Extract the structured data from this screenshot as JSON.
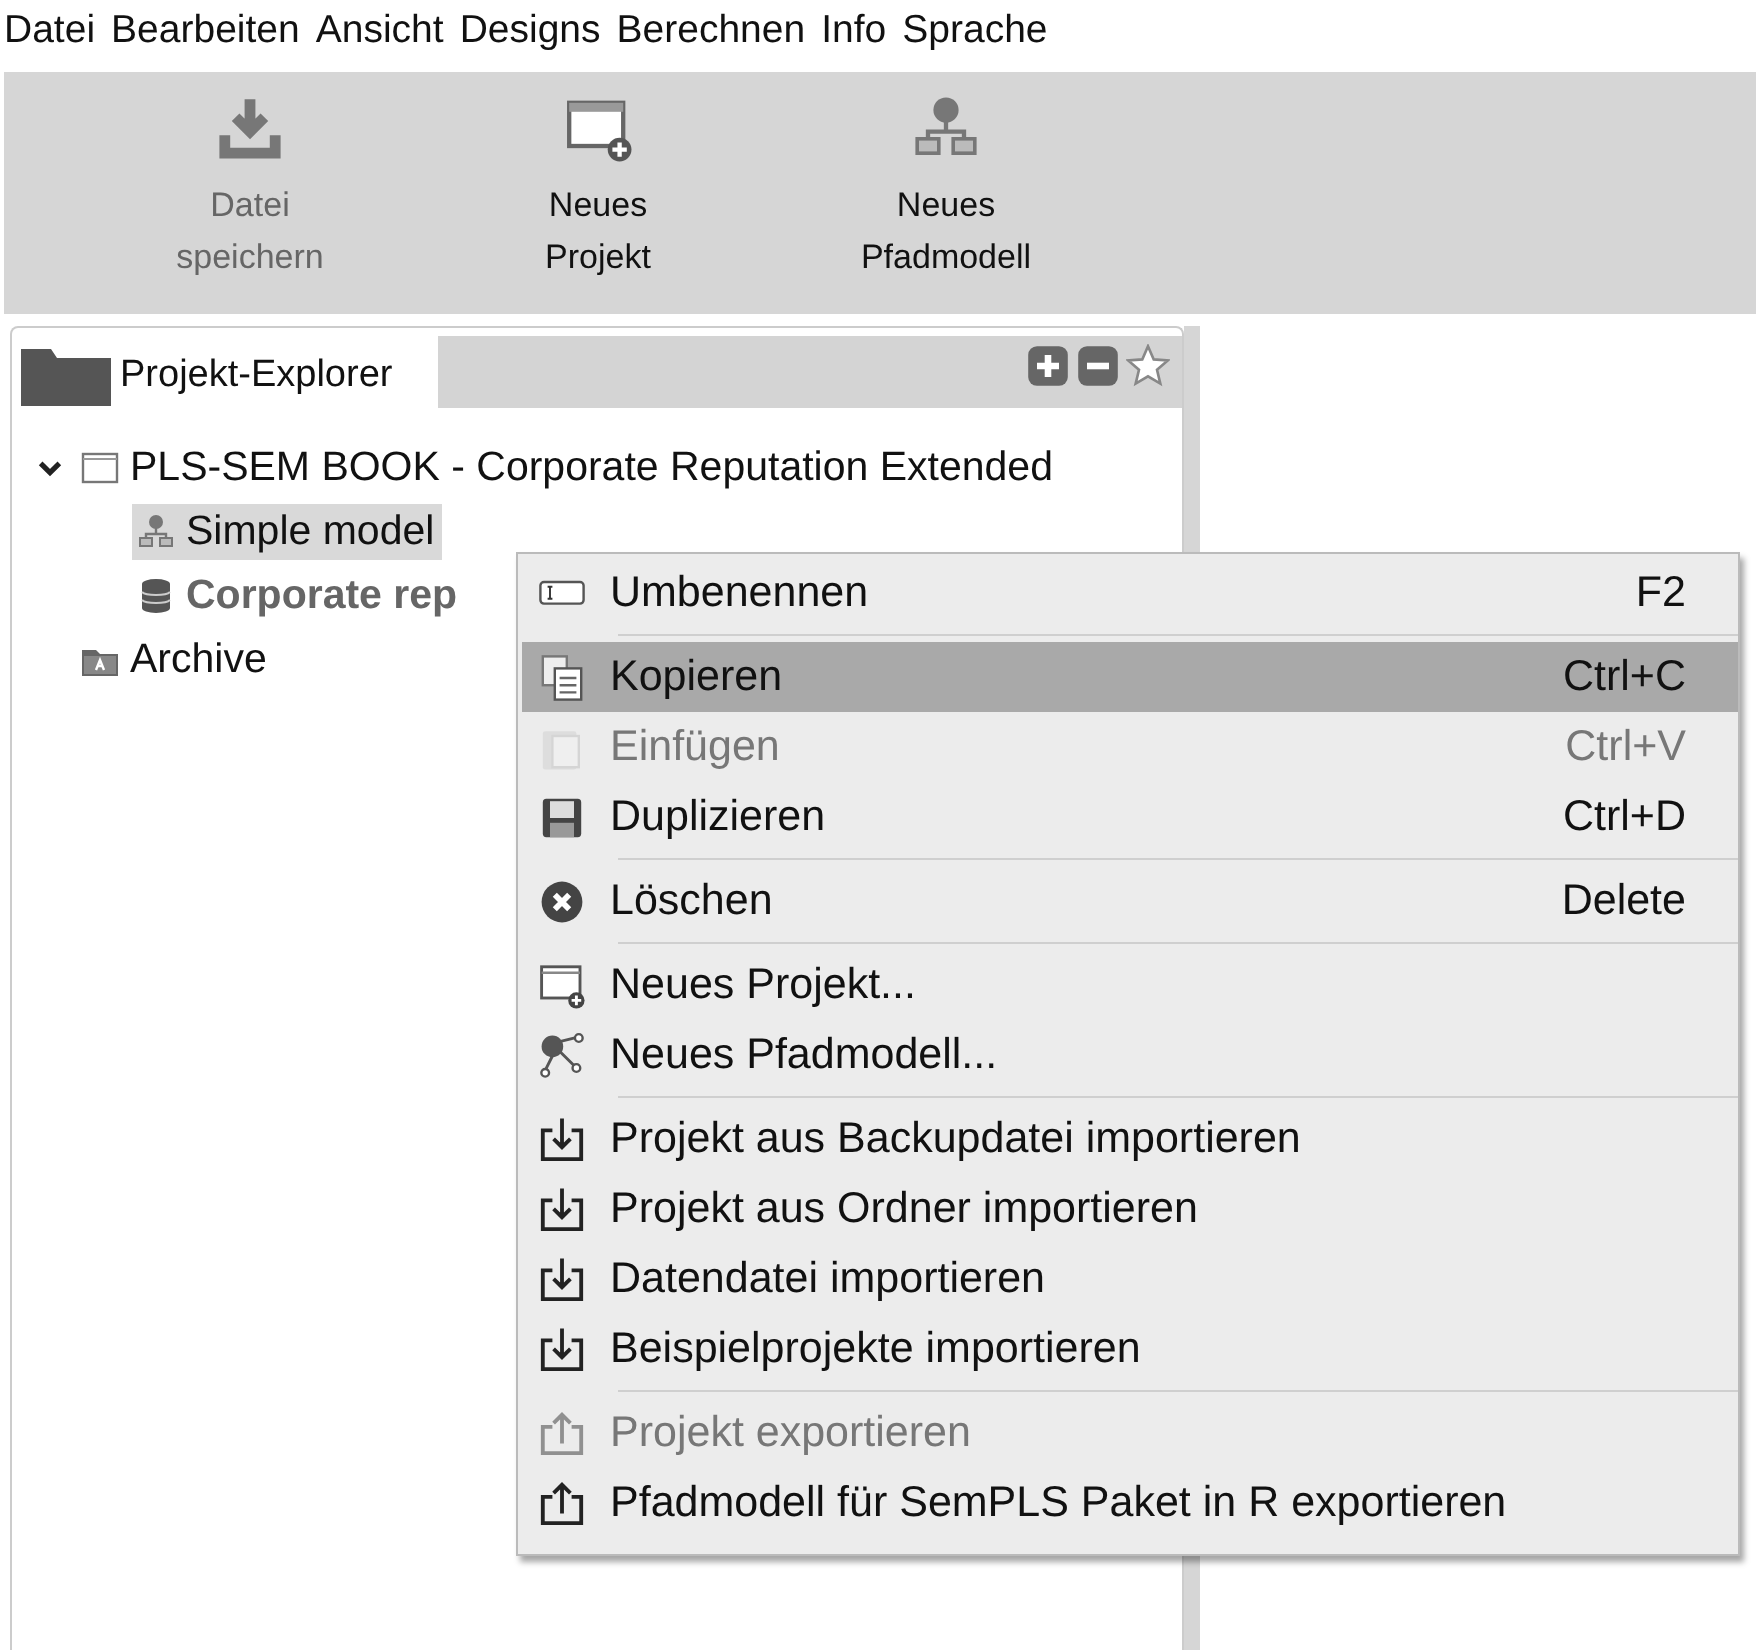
{
  "menu_bar": [
    "Datei",
    "Bearbeiten",
    "Ansicht",
    "Designs",
    "Berechnen",
    "Info",
    "Sprache"
  ],
  "toolbar": [
    {
      "kind": "save",
      "label": "Datei\nspeichern",
      "disabled": true
    },
    {
      "kind": "new-project",
      "label": "Neues\nProjekt",
      "disabled": false
    },
    {
      "kind": "new-model",
      "label": "Neues\nPfadmodell",
      "disabled": false
    }
  ],
  "explorer": {
    "tab": "Projekt-Explorer",
    "tree": [
      {
        "kind": "project",
        "label": "PLS-SEM BOOK - Corporate Reputation Extended",
        "expanded": true,
        "selected": false,
        "children": [
          {
            "kind": "model",
            "label": "Simple model",
            "selected": true,
            "bold": false
          },
          {
            "kind": "data",
            "label": "Corporate rep",
            "selected": false,
            "bold": true
          }
        ]
      },
      {
        "kind": "archive",
        "label": "Archive",
        "selected": false
      }
    ]
  },
  "context_menu": [
    [
      {
        "kind": "rename",
        "label": "Umbenennen",
        "shortcut": "F2",
        "selected": false,
        "disabled": false
      }
    ],
    [
      {
        "kind": "copy",
        "label": "Kopieren",
        "shortcut": "Ctrl+C",
        "selected": true,
        "disabled": false
      },
      {
        "kind": "paste",
        "label": "Einfügen",
        "shortcut": "Ctrl+V",
        "selected": false,
        "disabled": true
      },
      {
        "kind": "save",
        "label": "Duplizieren",
        "shortcut": "Ctrl+D",
        "selected": false,
        "disabled": false
      }
    ],
    [
      {
        "kind": "delete",
        "label": "Löschen",
        "shortcut": "Delete",
        "selected": false,
        "disabled": false
      }
    ],
    [
      {
        "kind": "new-project",
        "label": "Neues Projekt...",
        "selected": false,
        "disabled": false
      },
      {
        "kind": "new-model",
        "label": "Neues Pfadmodell...",
        "selected": false,
        "disabled": false
      }
    ],
    [
      {
        "kind": "import",
        "label": "Projekt aus Backupdatei importieren",
        "selected": false,
        "disabled": false
      },
      {
        "kind": "import",
        "label": "Projekt aus Ordner importieren",
        "selected": false,
        "disabled": false
      },
      {
        "kind": "import",
        "label": "Datendatei importieren",
        "selected": false,
        "disabled": false
      },
      {
        "kind": "import",
        "label": "Beispielprojekte importieren",
        "selected": false,
        "disabled": false
      }
    ],
    [
      {
        "kind": "export",
        "label": "Projekt exportieren",
        "selected": false,
        "disabled": true
      },
      {
        "kind": "export",
        "label": "Pfadmodell für SemPLS Paket in R exportieren",
        "selected": false,
        "disabled": false
      }
    ]
  ]
}
